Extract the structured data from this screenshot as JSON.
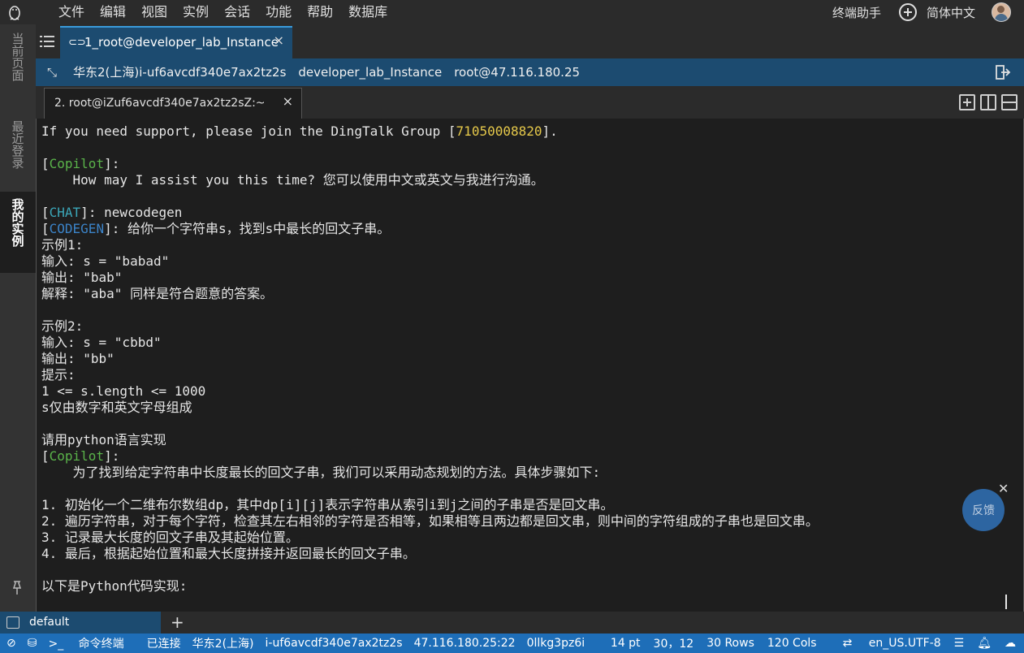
{
  "menubar": {
    "items": [
      "文件",
      "编辑",
      "视图",
      "实例",
      "会话",
      "功能",
      "帮助",
      "数据库"
    ],
    "assistant": "终端助手",
    "language": "简体中文"
  },
  "sidebar": {
    "tabs": [
      {
        "label": "当前页面",
        "active": false
      },
      {
        "label": "最近登录",
        "active": false
      },
      {
        "label": "我的实例",
        "active": true
      }
    ]
  },
  "session_tab": {
    "label": "1_root@developer_lab_Instance",
    "close": "×"
  },
  "infobar": {
    "region": "华东2(上海)i-uf6avcdf340e7ax2tz2s",
    "instance": "developer_lab_Instance",
    "login": "root@47.116.180.25"
  },
  "terminal_tab": {
    "label": "2. root@iZuf6avcdf340e7ax2tz2sZ:~",
    "close": "×"
  },
  "terminal": {
    "support_pre": "If you need support, please join the DingTalk Group [",
    "group_id": "71050008820",
    "support_post": "].",
    "copilot": "Copilot",
    "copilot_msg1": "    How may I assist you this time? 您可以使用中文或英文与我进行沟通。",
    "chat_tag": "CHAT",
    "chat_msg": ": newcodegen",
    "codegen_tag": "CODEGEN",
    "codegen_msg": ": 给你一个字符串s，找到s中最长的回文子串。",
    "prompt_lines": "示例1:\n输入: s = \"babad\"\n输出: \"bab\"\n解释: \"aba\" 同样是符合题意的答案。\n\n示例2:\n输入: s = \"cbbd\"\n输出: \"bb\"\n提示:\n1 <= s.length <= 1000\ns仅由数字和英文字母组成\n\n请用python语言实现",
    "copilot_msg2": "    为了找到给定字符串中长度最长的回文子串，我们可以采用动态规划的方法。具体步骤如下:",
    "steps": "1. 初始化一个二维布尔数组dp，其中dp[i][j]表示字符串从索引i到j之间的子串是否是回文串。\n2. 遍历字符串，对于每个字符，检查其左右相邻的字符是否相等，如果相等且两边都是回文串，则中间的字符组成的子串也是回文串。\n3. 记录最大长度的回文子串及其起始位置。\n4. 最后，根据起始位置和最大长度拼接并返回最长的回文子串。",
    "code_intro": "以下是Python代码实现:"
  },
  "feedback": {
    "label": "反馈"
  },
  "session_bar": {
    "default_label": "default",
    "add": "+"
  },
  "statusbar": {
    "cmd_terminal": "命令终端",
    "connected": "已连接",
    "region": "华东2(上海)",
    "instance_id": "i-uf6avcdf340e7ax2tz2s",
    "address": "47.116.180.25:22",
    "session_id": "0llkg3pz6i",
    "font_size": "14 pt",
    "cursor_pos": "30，12",
    "rows": "30 Rows",
    "cols": "120 Cols",
    "encoding": "en_US.UTF-8"
  },
  "colors": {
    "accent_blue": "#1c4b70",
    "status_blue": "#1e6eb8",
    "copilot_green": "#5ab44a",
    "group_yellow": "#e5c84a"
  }
}
